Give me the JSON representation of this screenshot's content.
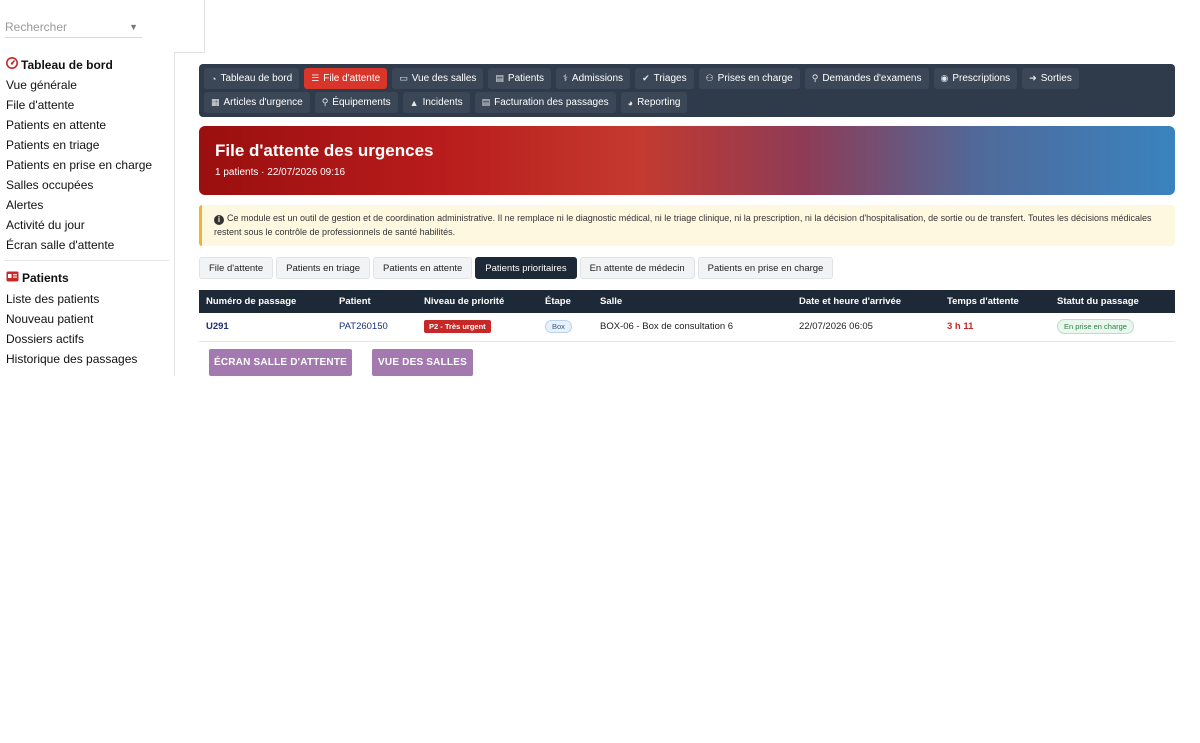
{
  "sidebar": {
    "search_placeholder": "Rechercher",
    "section1": {
      "title": "Tableau de bord",
      "icon": "gauge-icon",
      "items": [
        "Vue générale",
        "File d'attente",
        "Patients en attente",
        "Patients en triage",
        "Patients en prise en charge",
        "Salles occupées",
        "Alertes",
        "Activité du jour",
        "Écran salle d'attente"
      ]
    },
    "section2": {
      "title": "Patients",
      "icon": "id-card-icon",
      "items": [
        "Liste des patients",
        "Nouveau patient",
        "Dossiers actifs",
        "Historique des passages"
      ]
    }
  },
  "menu": {
    "row1": [
      {
        "label": "Tableau de bord",
        "icon": "gauge-icon",
        "active": false
      },
      {
        "label": "File d'attente",
        "icon": "list-icon",
        "active": true
      },
      {
        "label": "Vue des salles",
        "icon": "bed-icon",
        "active": false
      },
      {
        "label": "Patients",
        "icon": "id-card-icon",
        "active": false
      },
      {
        "label": "Admissions",
        "icon": "hospital-user-icon",
        "active": false
      },
      {
        "label": "Triages",
        "icon": "clipboard-check-icon",
        "active": false
      },
      {
        "label": "Prises en charge",
        "icon": "user-doctor-icon",
        "active": false
      },
      {
        "label": "Demandes d'examens",
        "icon": "microscope-icon",
        "active": false
      },
      {
        "label": "Prescriptions",
        "icon": "pills-icon",
        "active": false
      },
      {
        "label": "Sorties",
        "icon": "sign-out-icon",
        "active": false
      }
    ],
    "row2": [
      {
        "label": "Articles d'urgence",
        "icon": "boxes-icon",
        "active": false
      },
      {
        "label": "Équipements",
        "icon": "stethoscope-icon",
        "active": false
      },
      {
        "label": "Incidents",
        "icon": "warning-icon",
        "active": false
      },
      {
        "label": "Facturation des passages",
        "icon": "invoice-icon",
        "active": false
      },
      {
        "label": "Reporting",
        "icon": "chart-pie-icon",
        "active": false
      }
    ]
  },
  "banner": {
    "title": "File d'attente des urgences",
    "subtitle": "1 patients · 22/07/2026 09:16"
  },
  "notice": {
    "text": "Ce module est un outil de gestion et de coordination administrative. Il ne remplace ni le diagnostic médical, ni le triage clinique, ni la prescription, ni la décision d'hospitalisation, de sortie ou de transfert. Toutes les décisions médicales restent sous le contrôle de professionnels de santé habilités."
  },
  "tabs": [
    {
      "label": "File d'attente",
      "active": false
    },
    {
      "label": "Patients en triage",
      "active": false
    },
    {
      "label": "Patients en attente",
      "active": false
    },
    {
      "label": "Patients prioritaires",
      "active": true
    },
    {
      "label": "En attente de médecin",
      "active": false
    },
    {
      "label": "Patients en prise en charge",
      "active": false
    }
  ],
  "table": {
    "headers": [
      "Numéro de passage",
      "Patient",
      "Niveau de priorité",
      "Étape",
      "Salle",
      "Date et heure d'arrivée",
      "Temps d'attente",
      "Statut du passage"
    ],
    "rows": [
      {
        "numero": "U291",
        "patient": "PAT260150",
        "priorite": "P2 - Très urgent",
        "etape": "Box",
        "salle": "BOX-06 - Box de consultation 6",
        "arrivee": "22/07/2026 06:05",
        "attente": "3 h 11",
        "statut": "En prise en charge"
      }
    ]
  },
  "buttons": {
    "ecran": "ÉCRAN SALLE D'ATTENTE",
    "salles": "VUE DES SALLES"
  },
  "colors": {
    "accent_red": "#d9362b",
    "nav_dark": "#2f3a4a",
    "table_header": "#1e2938",
    "button_purple": "#a379b0"
  }
}
